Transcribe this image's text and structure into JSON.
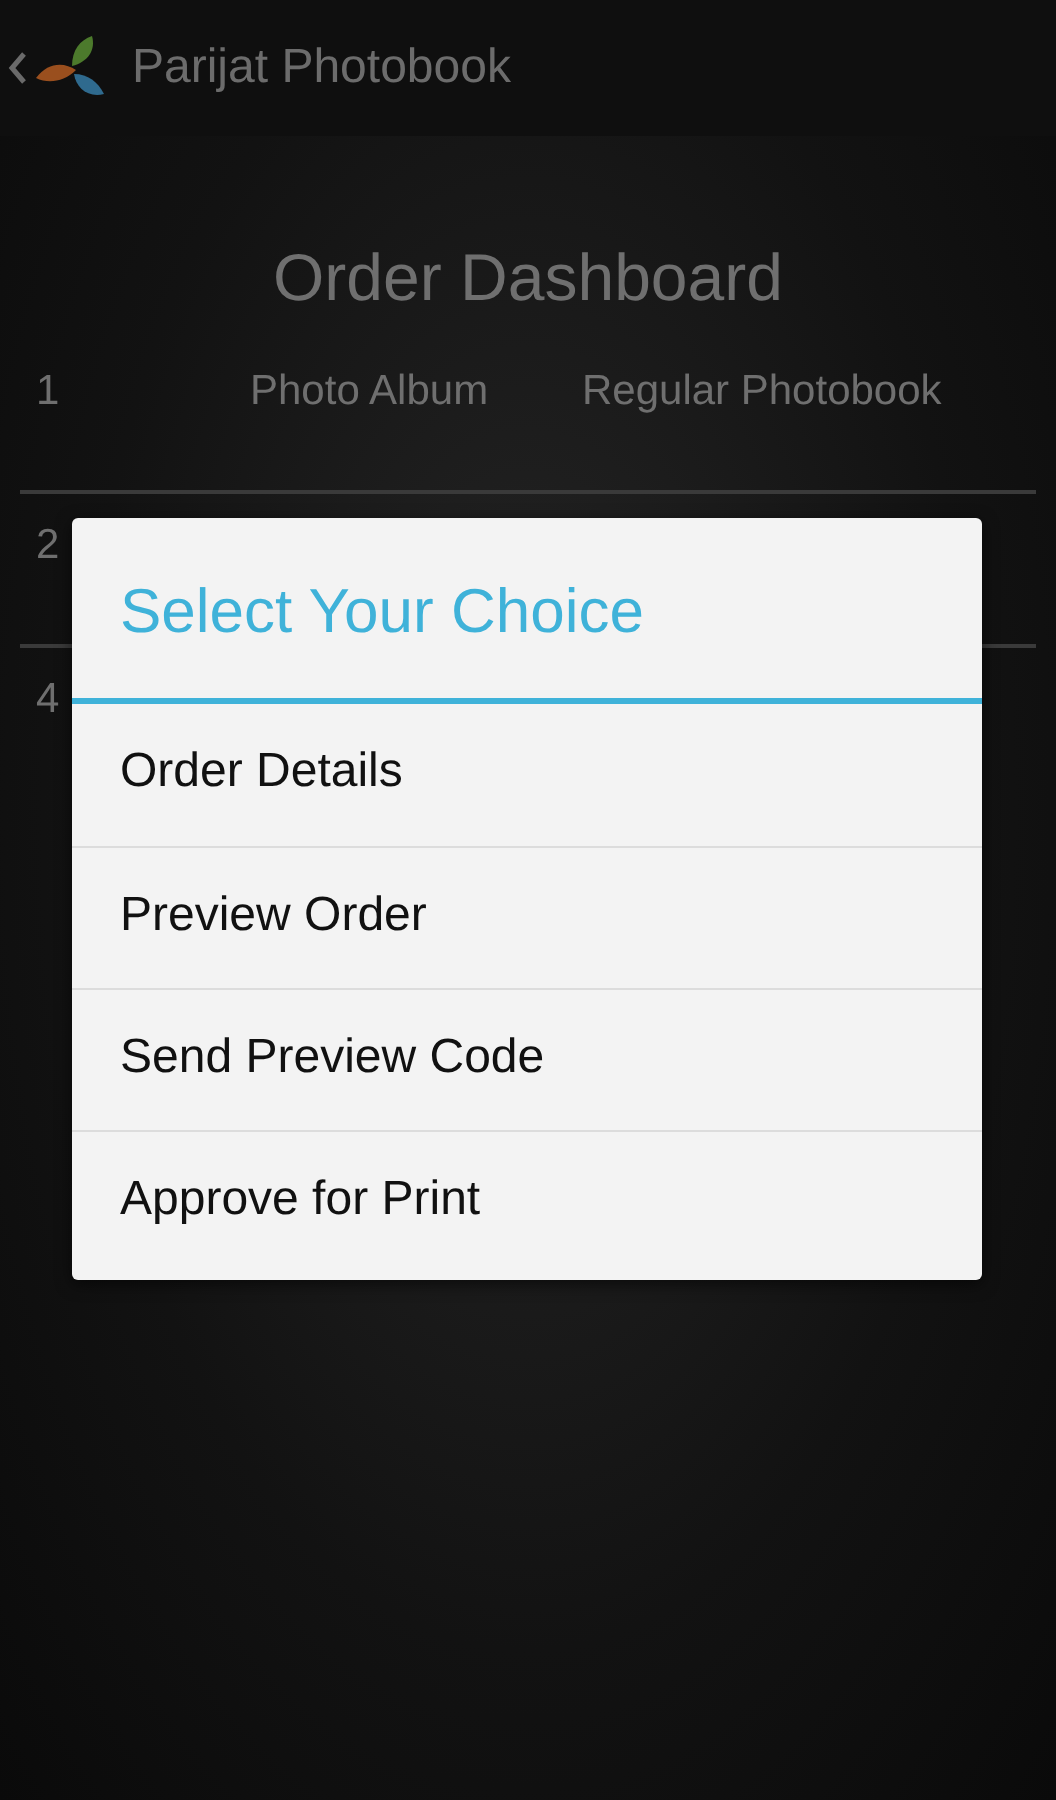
{
  "action_bar": {
    "title": "Parijat Photobook"
  },
  "dashboard": {
    "title": "Order Dashboard",
    "rows": [
      {
        "number": "1",
        "column_2": "Photo Album",
        "column_3": "Regular Photobook"
      },
      {
        "number": "2"
      },
      {
        "number": "4"
      }
    ]
  },
  "dialog": {
    "title": "Select Your Choice",
    "items": [
      "Order Details",
      "Preview Order",
      "Send Preview Code",
      "Approve for Print"
    ]
  }
}
